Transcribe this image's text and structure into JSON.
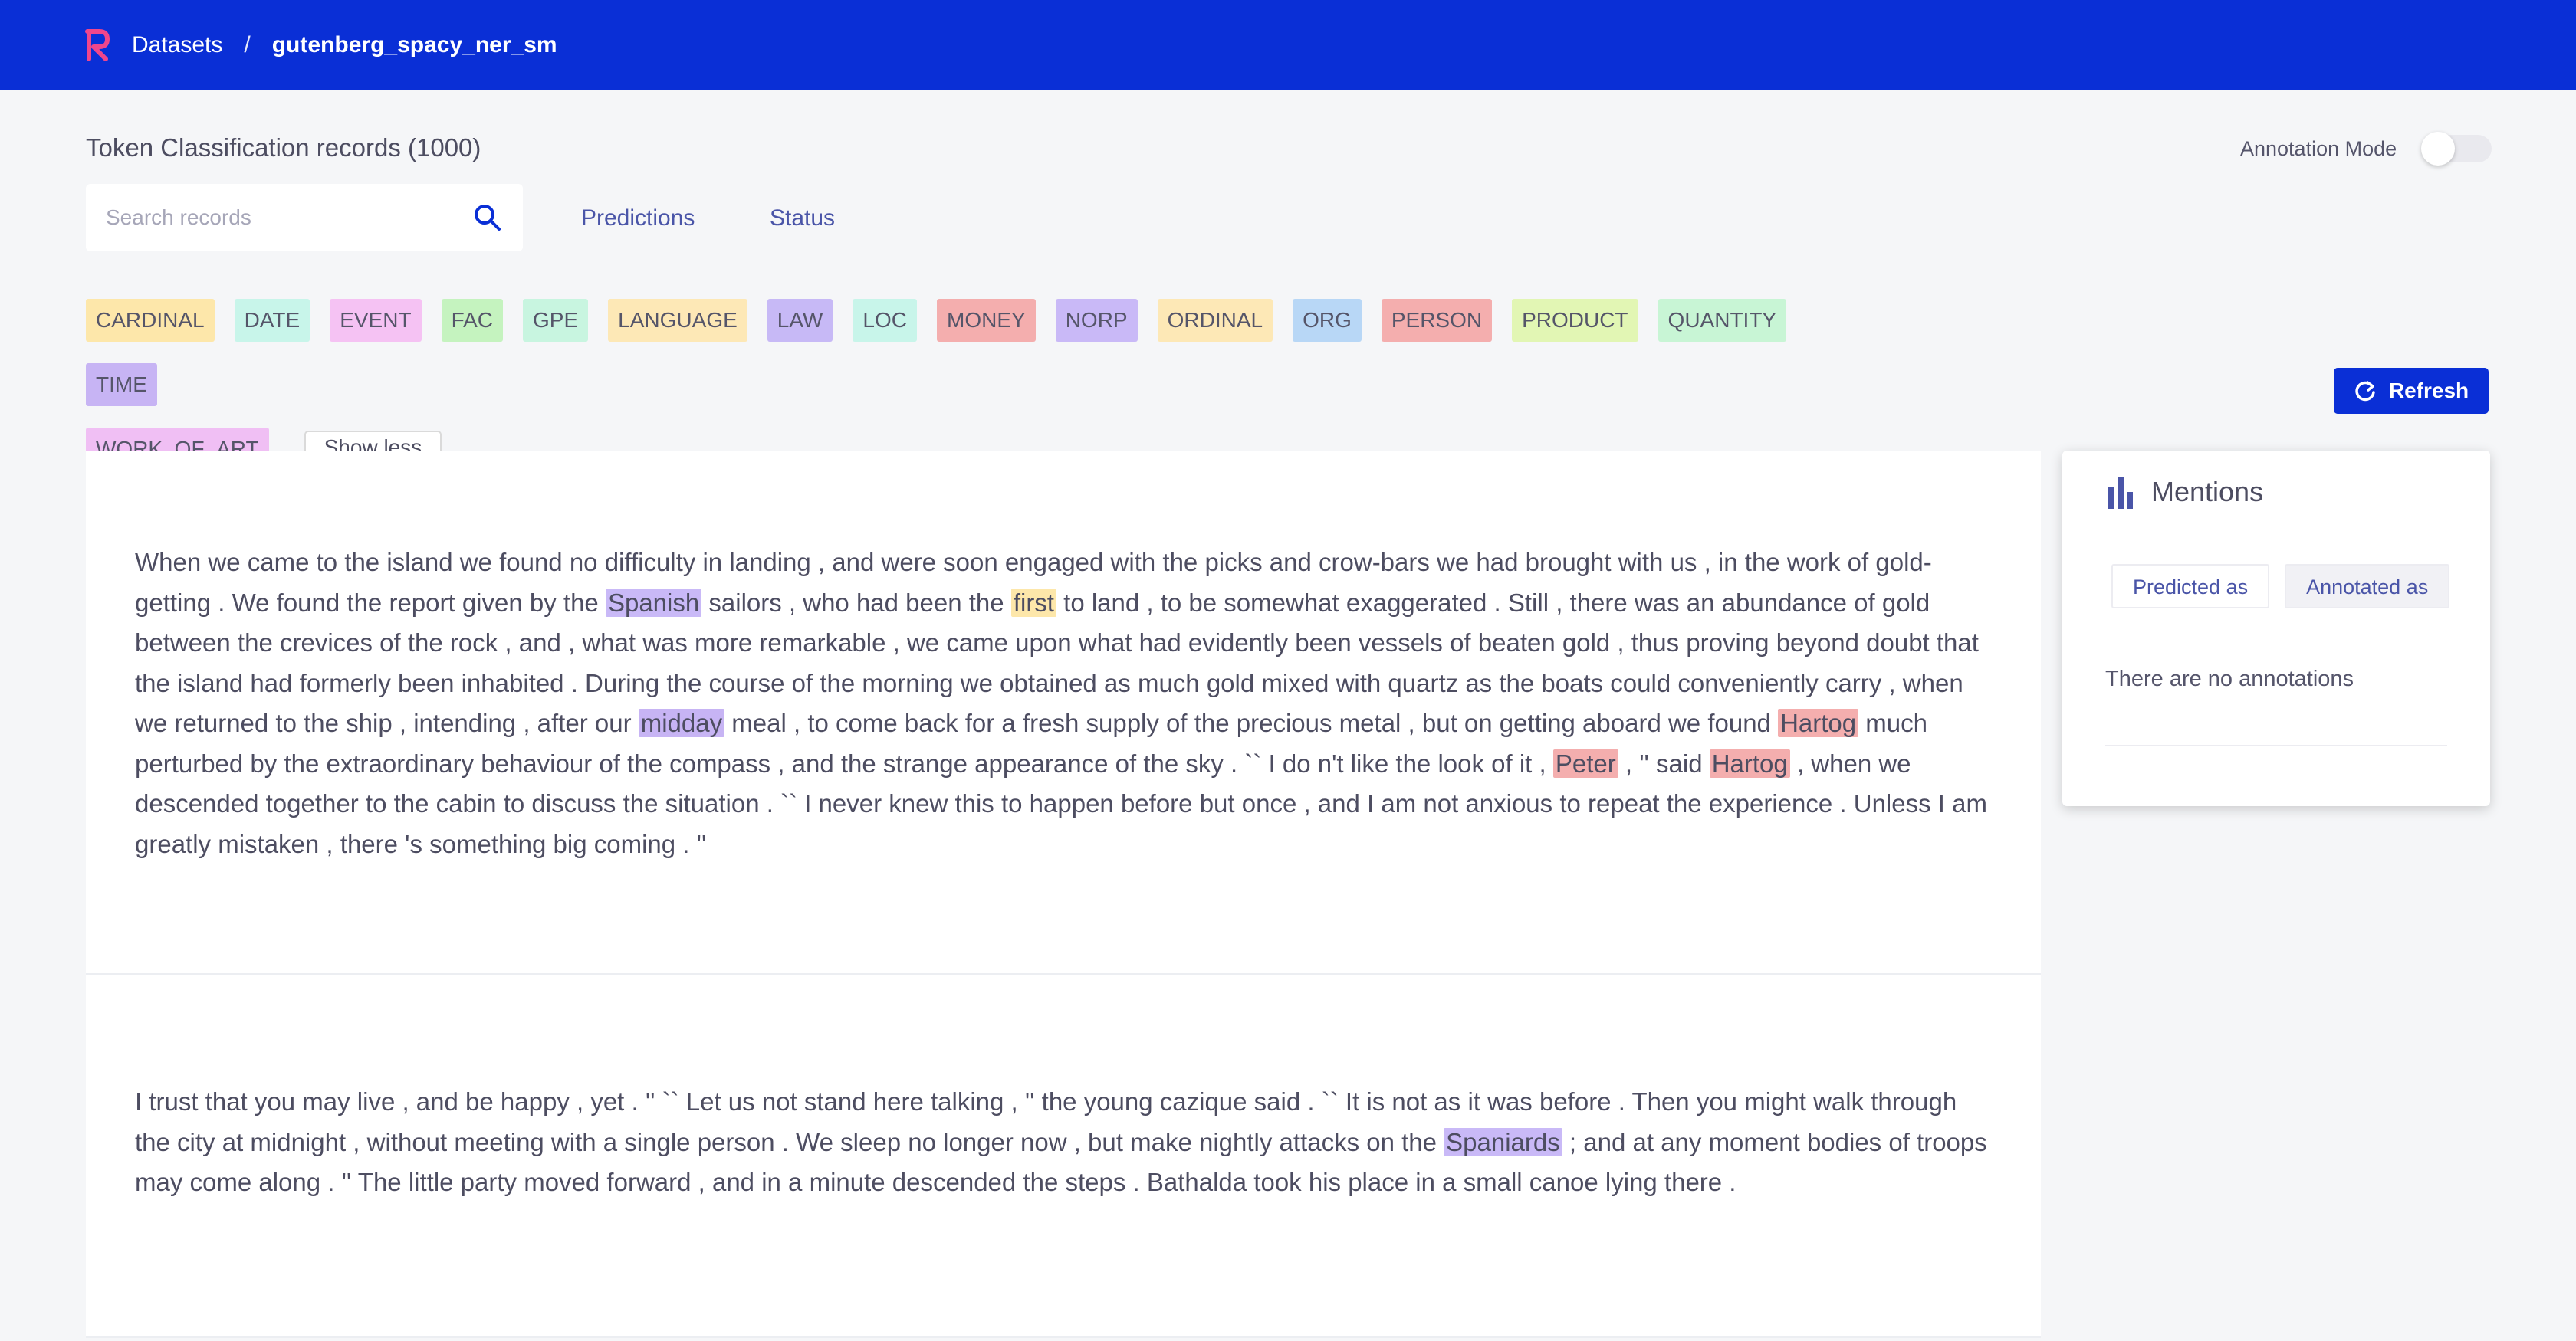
{
  "header": {
    "breadcrumb_root": "Datasets",
    "separator": "/",
    "dataset": "gutenberg_spacy_ner_sm"
  },
  "page": {
    "title": "Token Classification records (1000)",
    "annotation_mode_label": "Annotation Mode",
    "annotation_mode_on": false
  },
  "search": {
    "placeholder": "Search records"
  },
  "filters": {
    "predictions": "Predictions",
    "status": "Status"
  },
  "entity_tags": [
    {
      "label": "CARDINAL",
      "color": "#fde7aa"
    },
    {
      "label": "DATE",
      "color": "#c8f5ea"
    },
    {
      "label": "EVENT",
      "color": "#f5c2f3"
    },
    {
      "label": "FAC",
      "color": "#c5f3bf"
    },
    {
      "label": "GPE",
      "color": "#c8f5e0"
    },
    {
      "label": "LANGUAGE",
      "color": "#fde8b6"
    },
    {
      "label": "LAW",
      "color": "#c7b9f6"
    },
    {
      "label": "LOC",
      "color": "#c8f5ea"
    },
    {
      "label": "MONEY",
      "color": "#f4aeae"
    },
    {
      "label": "NORP",
      "color": "#c9b9f7"
    },
    {
      "label": "ORDINAL",
      "color": "#fde8b6"
    },
    {
      "label": "ORG",
      "color": "#b8d7f6"
    },
    {
      "label": "PERSON",
      "color": "#f4aeae"
    },
    {
      "label": "PRODUCT",
      "color": "#e2f6b4"
    },
    {
      "label": "QUANTITY",
      "color": "#c8f5d5"
    },
    {
      "label": "TIME",
      "color": "#c7b4f4"
    },
    {
      "label": "WORK_OF_ART",
      "color": "#f0bff4"
    }
  ],
  "show_less_label": "Show less",
  "refresh_label": "Refresh",
  "records": [
    {
      "text_1": "When we came to the island we found no difficulty in landing , and were soon engaged with the picks and crow-bars we had brought with us , in the work of gold-getting . We found the report given by the ",
      "ent_1": "Spanish",
      "text_2": " sailors , who had been the ",
      "ent_2": "first",
      "text_3": " to land , to be somewhat exaggerated . Still , there was an abundance of gold between the crevices of the rock , and , what was more remarkable , we came upon what had evidently been vessels of beaten gold , thus proving beyond doubt that the island had formerly been inhabited . During the course of the morning we obtained as much gold mixed with quartz as the boats could conveniently carry , when we returned to the ship , intending , after our ",
      "ent_3": "midday",
      "text_4": " meal , to come back for a fresh supply of the precious metal , but on getting aboard we found ",
      "ent_4": "Hartog",
      "text_5": " much perturbed by the extraordinary behaviour of the compass , and the strange appearance of the sky . `` I do n't like the look of it , ",
      "ent_5": "Peter",
      "text_6": " , '' said ",
      "ent_6": "Hartog",
      "text_7": " , when we descended together to the cabin to discuss the situation . `` I never knew this to happen before but once , and I am not anxious to repeat the experience . Unless I am greatly mistaken , there 's something big coming . ''"
    },
    {
      "text_1": "I trust that you may live , and be happy , yet . '' `` Let us not stand here talking , '' the young cazique said . `` It is not as it was before . Then you might walk through the city at midnight , without meeting with a single person . We sleep no longer now , but make nightly attacks on the ",
      "ent_1": "Spaniards",
      "text_2": " ; and at any moment bodies of troops may come along . '' The little party moved forward , and in a minute descended the steps . Bathalda took his place in a small canoe lying there ."
    }
  ],
  "mentions": {
    "title": "Mentions",
    "tab_predicted": "Predicted as",
    "tab_annotated": "Annotated as",
    "empty_text": "There are no annotations"
  },
  "colors": {
    "brand": "#0a2fd6",
    "accent_text": "#4a55a8",
    "logo_pink": "#f0468c"
  }
}
